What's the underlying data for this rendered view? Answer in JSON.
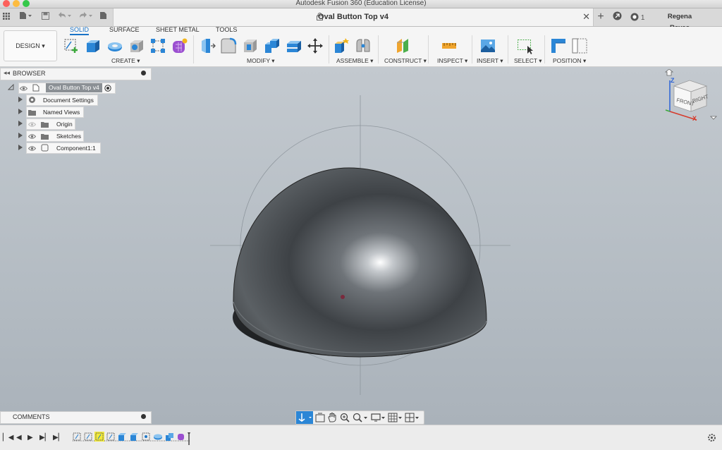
{
  "window": {
    "app_title": "Autodesk Fusion 360 (Education License)"
  },
  "tabbar": {
    "document_title": "Oval Button Top v4",
    "job_count": "1",
    "user_name": "Regena Reyes"
  },
  "ribbon": {
    "workspace": "DESIGN ▾",
    "tabs": [
      "SOLID",
      "SURFACE",
      "SHEET METAL",
      "TOOLS"
    ],
    "groups": [
      "CREATE ▾",
      "MODIFY ▾",
      "ASSEMBLE ▾",
      "CONSTRUCT ▾",
      "INSPECT ▾",
      "INSERT ▾",
      "SELECT ▾",
      "POSITION ▾"
    ]
  },
  "browser": {
    "title": "BROWSER",
    "items": [
      {
        "label": "Oval Button Top v4",
        "icon": "document-icon"
      },
      {
        "label": "Document Settings",
        "icon": "gear-icon"
      },
      {
        "label": "Named Views",
        "icon": "folder-icon"
      },
      {
        "label": "Origin",
        "icon": "folder-icon"
      },
      {
        "label": "Sketches",
        "icon": "folder-icon"
      },
      {
        "label": "Component1:1",
        "icon": "component-icon"
      }
    ]
  },
  "comments": {
    "title": "COMMENTS"
  },
  "viewcube": {
    "front": "FRONT",
    "right": "RIGHT",
    "axis_z": "Z",
    "axis_x": "X"
  },
  "colors": {
    "accent": "#1a73c7",
    "viewport_bg": "#b9c0c7",
    "selection": "#f2ea3a"
  }
}
